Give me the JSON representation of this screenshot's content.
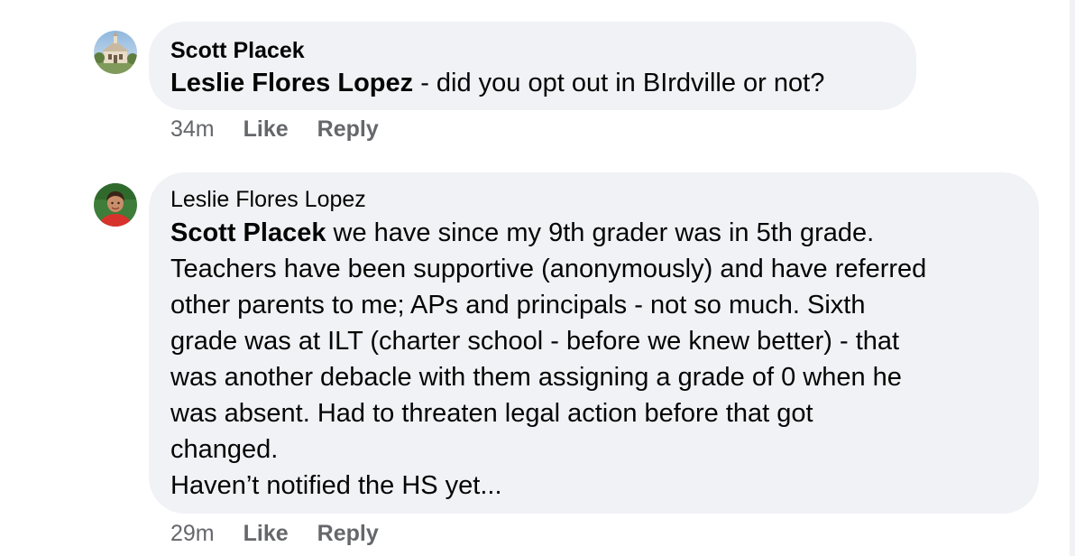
{
  "comments": [
    {
      "author": "Scott Placek",
      "mention": "Leslie Flores Lopez",
      "text": " - did you opt out in BIrdville or not?",
      "time": "34m",
      "like_label": "Like",
      "reply_label": "Reply"
    },
    {
      "author": "Leslie Flores Lopez",
      "mention": "Scott Placek",
      "lines": [
        " we have since my 9th grader was in 5th grade.",
        "Teachers have been supportive (anonymously) and have referred",
        "other parents to me; APs and principals - not so much. Sixth",
        "grade was at ILT (charter school - before we knew better) - that",
        "was another debacle with them assigning a grade of 0 when he",
        "was absent. Had to threaten legal action before that got",
        "changed.",
        "Haven’t notified the HS yet..."
      ],
      "time": "29m",
      "like_label": "Like",
      "reply_label": "Reply"
    }
  ]
}
